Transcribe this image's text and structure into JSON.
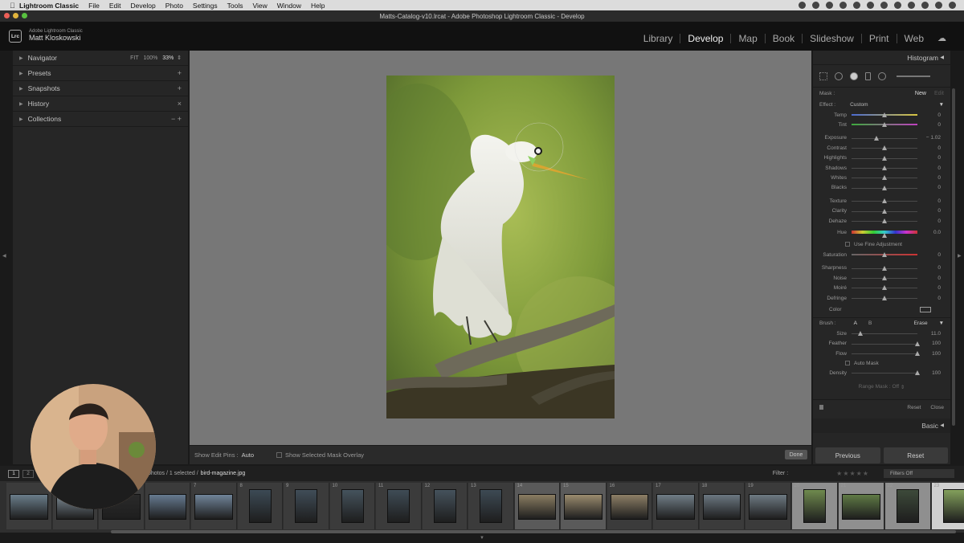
{
  "menubar": {
    "app": "Lightroom Classic",
    "items": [
      "File",
      "Edit",
      "Develop",
      "Photo",
      "Settings",
      "Tools",
      "View",
      "Window",
      "Help"
    ]
  },
  "window": {
    "title": "Matts-Catalog-v10.lrcat - Adobe Photoshop Lightroom Classic - Develop"
  },
  "identity": {
    "logo": "Lrc",
    "product": "Adobe Lightroom Classic",
    "user": "Matt Kloskowski"
  },
  "modules": [
    "Library",
    "Develop",
    "Map",
    "Book",
    "Slideshow",
    "Print",
    "Web"
  ],
  "active_module": "Develop",
  "left_panel": {
    "navigator": {
      "label": "Navigator",
      "zoom": [
        "FIT",
        "100%",
        "33%"
      ]
    },
    "sections": [
      {
        "label": "Presets",
        "action": "+"
      },
      {
        "label": "Snapshots",
        "action": "+"
      },
      {
        "label": "History",
        "action": "×"
      },
      {
        "label": "Collections",
        "action": "− +"
      }
    ]
  },
  "right_panel": {
    "histogram": "Histogram",
    "mask": {
      "label": "Mask :",
      "new": "New",
      "edit": "Edit"
    },
    "effect": {
      "label": "Effect :",
      "value": "Custom"
    },
    "sliders": [
      {
        "label": "Temp",
        "value": "0",
        "pos": 0.5,
        "grad": "temp"
      },
      {
        "label": "Tint",
        "value": "0",
        "pos": 0.5,
        "grad": "tint"
      },
      {
        "label": "Exposure",
        "value": "− 1.02",
        "pos": 0.38,
        "gap_before": true
      },
      {
        "label": "Contrast",
        "value": "0",
        "pos": 0.5
      },
      {
        "label": "Highlights",
        "value": "0",
        "pos": 0.5
      },
      {
        "label": "Shadows",
        "value": "0",
        "pos": 0.5
      },
      {
        "label": "Whites",
        "value": "0",
        "pos": 0.5
      },
      {
        "label": "Blacks",
        "value": "0",
        "pos": 0.5
      },
      {
        "label": "Texture",
        "value": "0",
        "pos": 0.5,
        "gap_before": true
      },
      {
        "label": "Clarity",
        "value": "0",
        "pos": 0.5
      },
      {
        "label": "Dehaze",
        "value": "0",
        "pos": 0.5
      }
    ],
    "hue": {
      "label": "Hue",
      "value": "0.0",
      "pos": 0.5
    },
    "fine_adjust": "Use Fine Adjustment",
    "sliders2": [
      {
        "label": "Saturation",
        "value": "0",
        "pos": 0.5,
        "grad": "sat"
      },
      {
        "label": "Sharpness",
        "value": "0",
        "pos": 0.5,
        "gap_before": true
      },
      {
        "label": "Noise",
        "value": "0",
        "pos": 0.5
      },
      {
        "label": "Moiré",
        "value": "0",
        "pos": 0.5
      },
      {
        "label": "Defringe",
        "value": "0",
        "pos": 0.5
      }
    ],
    "color": {
      "label": "Color"
    },
    "brush": {
      "label": "Brush :",
      "a": "A",
      "b": "B",
      "erase": "Erase"
    },
    "brush_sliders": [
      {
        "label": "Size",
        "value": "11.0",
        "pos": 0.14
      },
      {
        "label": "Feather",
        "value": "100",
        "pos": 1.0
      },
      {
        "label": "Flow",
        "value": "100",
        "pos": 1.0
      }
    ],
    "auto_mask": "Auto Mask",
    "density": {
      "label": "Density",
      "value": "100",
      "pos": 1.0
    },
    "range_mask": {
      "label": "Range Mask :",
      "value": "Off"
    },
    "reset": "Reset",
    "close": "Close",
    "basic": "Basic"
  },
  "buttons": {
    "previous": "Previous",
    "reset": "Reset"
  },
  "toolbar": {
    "show_pins_label": "Show Edit Pins :",
    "show_pins_value": "Auto",
    "overlay": "Show Selected Mask Overlay",
    "done": "Done"
  },
  "filmstrip": {
    "pages": [
      "1",
      "2"
    ],
    "info": "photos / 1 selected /",
    "filename": "bird-magazine.jpg",
    "filter_label": "Filter :",
    "filters_off": "Filters Off",
    "cells": [
      {
        "num": "",
        "tone": "#6a7d8a"
      },
      {
        "num": "4",
        "tone": "#7d8b95"
      },
      {
        "num": "",
        "tone": "#2a2a2a"
      },
      {
        "num": "",
        "tone": "#667a90"
      },
      {
        "num": "7",
        "tone": "#708499"
      },
      {
        "num": "8",
        "tone": "#3c4a55"
      },
      {
        "num": "9",
        "tone": "#404d58"
      },
      {
        "num": "10",
        "tone": "#45535d"
      },
      {
        "num": "11",
        "tone": "#3f4c56"
      },
      {
        "num": "12",
        "tone": "#45525c"
      },
      {
        "num": "13",
        "tone": "#3d4a54"
      },
      {
        "num": "14",
        "tone": "#8a7d62"
      },
      {
        "num": "15",
        "tone": "#9a8b6e"
      },
      {
        "num": "16",
        "tone": "#8d7f66"
      },
      {
        "num": "17",
        "tone": "#707d86"
      },
      {
        "num": "18",
        "tone": "#6b7781"
      },
      {
        "num": "19",
        "tone": "#6e7a83"
      },
      {
        "num": "20",
        "tone": "#6f8a4e"
      },
      {
        "num": "21",
        "tone": "#5f7a45"
      },
      {
        "num": "22",
        "tone": "#3d4a3a"
      },
      {
        "num": "23",
        "tone": "#83a05c"
      }
    ]
  }
}
